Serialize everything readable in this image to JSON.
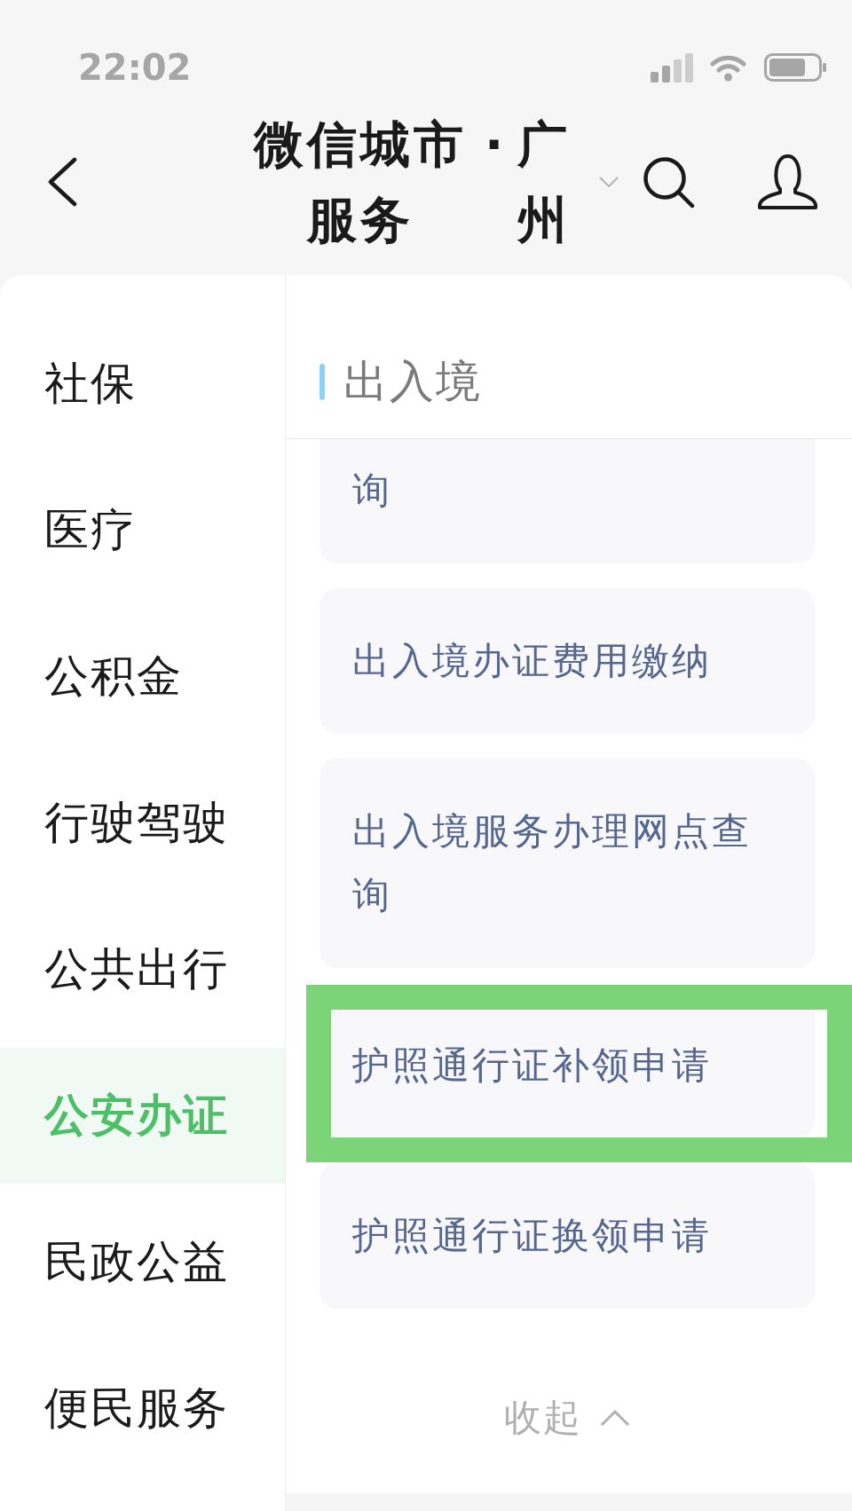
{
  "status_bar": {
    "time": "22:02"
  },
  "header": {
    "title": "微信城市服务",
    "separator": "·",
    "city": "广州"
  },
  "sidebar": {
    "items": [
      {
        "label": "社保",
        "selected": false
      },
      {
        "label": "医疗",
        "selected": false
      },
      {
        "label": "公积金",
        "selected": false
      },
      {
        "label": "行驶驾驶",
        "selected": false
      },
      {
        "label": "公共出行",
        "selected": false
      },
      {
        "label": "公安办证",
        "selected": true
      },
      {
        "label": "民政公益",
        "selected": false
      },
      {
        "label": "便民服务",
        "selected": false
      }
    ]
  },
  "section": {
    "title": "出入境",
    "items": [
      {
        "label": "询",
        "highlighted": false
      },
      {
        "label": "出入境办证费用缴纳",
        "highlighted": false
      },
      {
        "label": "出入境服务办理网点查询",
        "highlighted": false
      },
      {
        "label": "护照通行证补领申请",
        "highlighted": true
      },
      {
        "label": "护照通行证换领申请",
        "highlighted": false
      }
    ],
    "collapse_label": "收起"
  }
}
